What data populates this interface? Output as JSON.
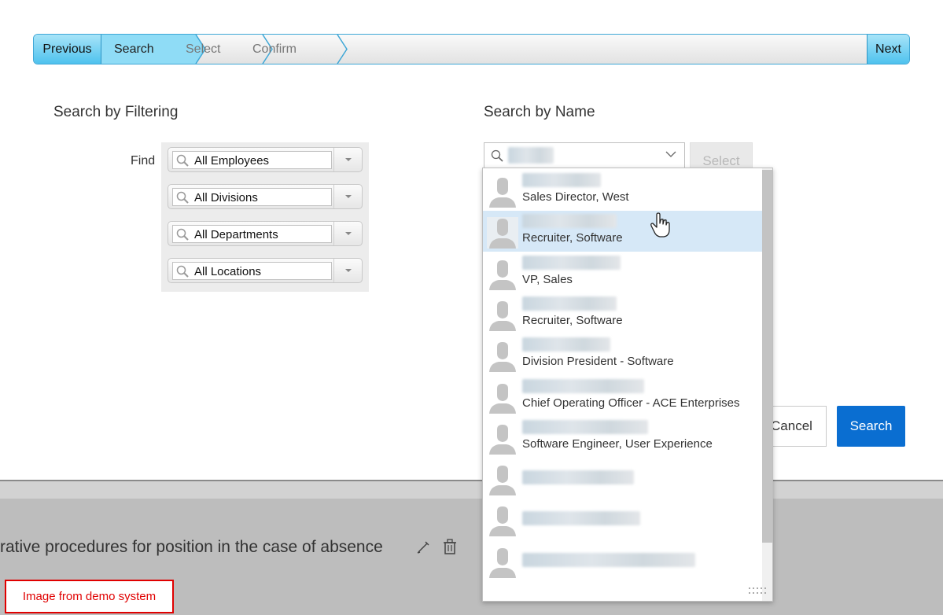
{
  "wizard": {
    "previous_label": "Previous",
    "next_label": "Next",
    "steps": [
      "Search",
      "Select",
      "Confirm"
    ]
  },
  "filter_section": {
    "title": "Search by Filtering",
    "find_label": "Find",
    "filters": [
      "All Employees",
      "All Divisions",
      "All Departments",
      "All Locations"
    ]
  },
  "name_section": {
    "title": "Search by Name",
    "select_label": "Select"
  },
  "buttons": {
    "cancel_label": "Cancel",
    "search_label": "Search"
  },
  "results": [
    {
      "title": "Sales Director, West"
    },
    {
      "title": "Recruiter, Software"
    },
    {
      "title": "VP, Sales"
    },
    {
      "title": "Recruiter, Software"
    },
    {
      "title": "Division President - Software"
    },
    {
      "title": "Chief Operating Officer - ACE Enterprises"
    },
    {
      "title": "Software Engineer, User Experience"
    },
    {
      "title": ""
    },
    {
      "title": ""
    },
    {
      "title": ""
    }
  ],
  "background_page": {
    "text": "rative procedures for position in the case of absence"
  },
  "watermark": "Image from demo system",
  "colors": {
    "accent": "#0a6ed1",
    "wizard_active": "#4ec2ee",
    "hover_row": "#d6e8f7",
    "watermark_red": "#e00000"
  },
  "icons": [
    "search-icon",
    "chevron-down-icon",
    "pencil-icon",
    "trash-icon",
    "avatar-icon",
    "hand-cursor-icon",
    "resize-grip-icon"
  ]
}
